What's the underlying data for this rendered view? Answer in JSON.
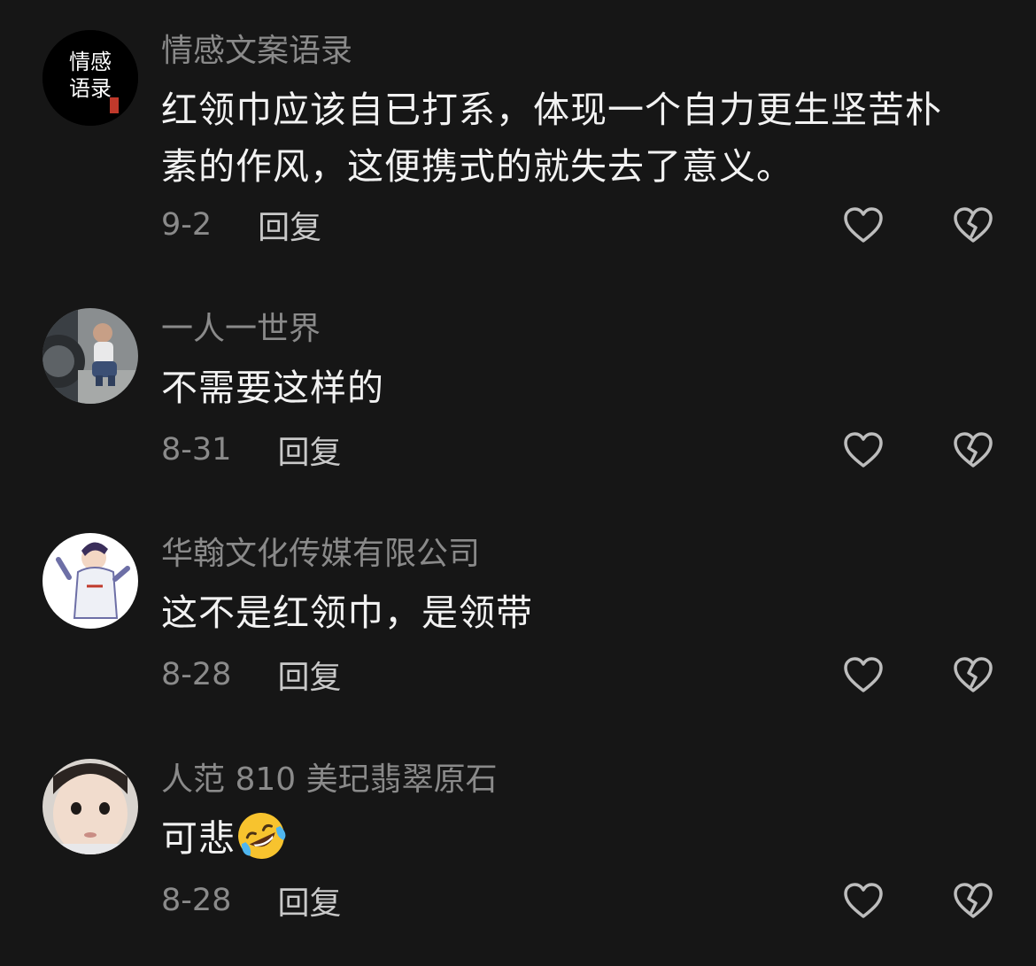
{
  "comments": [
    {
      "username": "情感文案语录",
      "text": "红领巾应该自已打系，体现一个自力更生坚苦朴素的作风，这便携式的就失去了意义。",
      "date": "9-2",
      "reply_label": "回复",
      "avatar_text_top": "情感",
      "avatar_text_bottom": "语录"
    },
    {
      "username": "一人一世界",
      "text": "不需要这样的",
      "date": "8-31",
      "reply_label": "回复"
    },
    {
      "username": "华翰文化传媒有限公司",
      "text": "这不是红领巾，是领带",
      "date": "8-28",
      "reply_label": "回复"
    },
    {
      "username": "人范 810 美玘翡翠原石",
      "text": "可悲",
      "emoji": "rolling-on-floor-laughing-emoji",
      "date": "8-28",
      "reply_label": "回复"
    }
  ],
  "icons": {
    "like": "heart-outline-icon",
    "dislike": "broken-heart-icon"
  },
  "colors": {
    "background": "#161616",
    "username": "#8a8a8a",
    "text": "#f2f2f2",
    "reply": "#c9c9c9",
    "icon": "#bdbdbd"
  }
}
